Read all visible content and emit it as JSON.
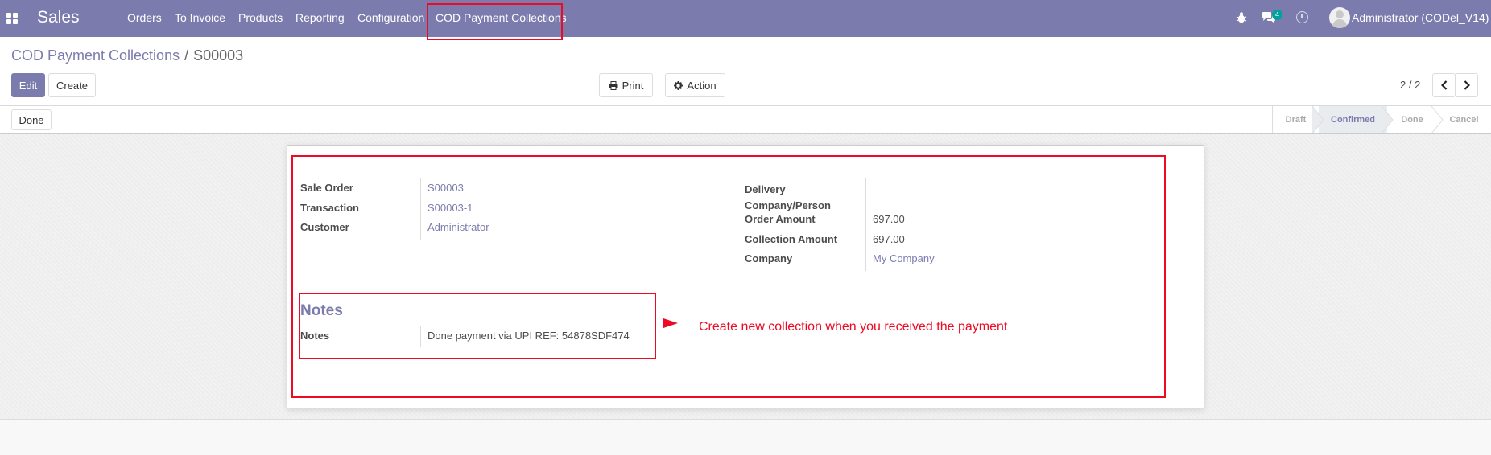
{
  "navbar": {
    "brand": "Sales",
    "menu": [
      "Orders",
      "To Invoice",
      "Products",
      "Reporting",
      "Configuration",
      "COD Payment Collections"
    ],
    "chat_badge": "4",
    "user": "Administrator (CODel_V14)"
  },
  "breadcrumb": {
    "parent": "COD Payment Collections",
    "separator": "/",
    "current": "S00003"
  },
  "buttons": {
    "edit": "Edit",
    "create": "Create",
    "print": "Print",
    "action": "Action",
    "done": "Done"
  },
  "pager": {
    "value": "2 / 2"
  },
  "statusbar": {
    "stages": [
      "Draft",
      "Confirmed",
      "Done",
      "Cancel"
    ],
    "active": "Confirmed"
  },
  "form": {
    "left": [
      {
        "label": "Sale Order",
        "value": "S00003"
      },
      {
        "label": "Transaction",
        "value": "S00003-1"
      },
      {
        "label": "Customer",
        "value": "Administrator"
      }
    ],
    "right": [
      {
        "label": "Delivery\nCompany/Person",
        "value": ""
      },
      {
        "label": "Order Amount",
        "value": "697.00"
      },
      {
        "label": "Collection Amount",
        "value": "697.00"
      },
      {
        "label": "Company",
        "value": "My Company"
      }
    ],
    "notes_title": "Notes",
    "notes_label": "Notes",
    "notes_value": "Done payment via UPI REF: 54878SDF474"
  },
  "annotation": {
    "text": "Create new collection when you received the payment",
    "color": "#ee0a24"
  },
  "colors": {
    "brand": "#7c7bad"
  }
}
